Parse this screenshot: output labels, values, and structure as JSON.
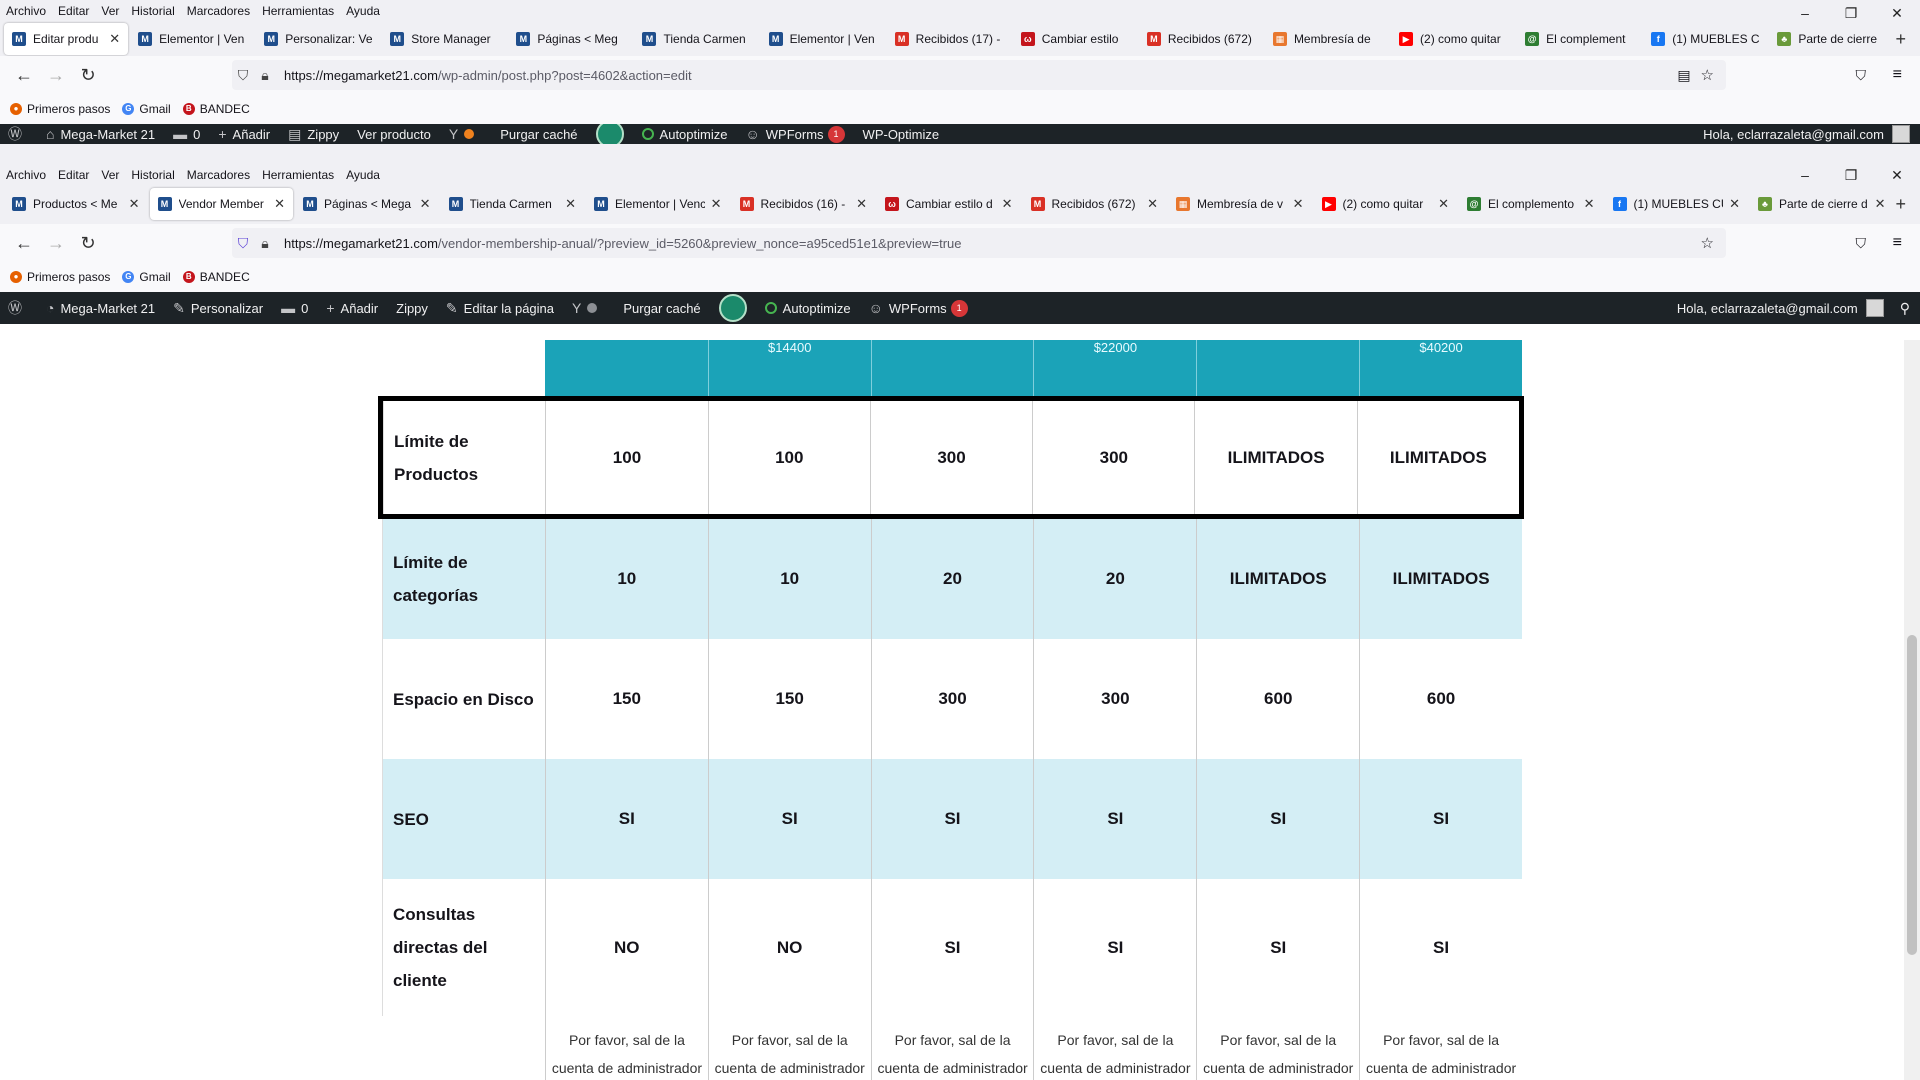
{
  "menu": [
    "Archivo",
    "Editar",
    "Ver",
    "Historial",
    "Marcadores",
    "Herramientas",
    "Ayuda"
  ],
  "w1": {
    "tabs": [
      {
        "label": "Editar produ",
        "icon": "M",
        "color": "#1f4e8c",
        "active": true
      },
      {
        "label": "Elementor | Ven",
        "icon": "M",
        "color": "#1f4e8c"
      },
      {
        "label": "Personalizar: Ve",
        "icon": "M",
        "color": "#1f4e8c"
      },
      {
        "label": "Store Manager",
        "icon": "M",
        "color": "#1f4e8c"
      },
      {
        "label": "Páginas < Meg",
        "icon": "M",
        "color": "#1f4e8c"
      },
      {
        "label": "Tienda Carmen",
        "icon": "M",
        "color": "#1f4e8c"
      },
      {
        "label": "Elementor | Ven",
        "icon": "M",
        "color": "#1f4e8c"
      },
      {
        "label": "Recibidos (17) -",
        "icon": "M",
        "color": "#d93025"
      },
      {
        "label": "Cambiar estilo",
        "icon": "ω",
        "color": "#c4151c"
      },
      {
        "label": "Recibidos (672)",
        "icon": "M",
        "color": "#d93025"
      },
      {
        "label": "Membresía de",
        "icon": "▦",
        "color": "#e8772e"
      },
      {
        "label": "(2) como quitar",
        "icon": "▶",
        "color": "#ff0000"
      },
      {
        "label": "El complement",
        "icon": "@",
        "color": "#2e7d32"
      },
      {
        "label": "(1) MUEBLES C",
        "icon": "f",
        "color": "#1877f2"
      },
      {
        "label": "Parte de cierre",
        "icon": "♣",
        "color": "#6a9a3a"
      }
    ],
    "url_host": "https://megamarket21.com",
    "url_path": "/wp-admin/post.php?post=4602&action=edit",
    "admin": {
      "site": "Mega-Market 21",
      "comments": "0",
      "add": "Añadir",
      "zippy": "Zippy",
      "view": "Ver producto",
      "cache": "Purgar caché",
      "autoptimize": "Autoptimize",
      "wpforms": "WPForms",
      "wpforms_badge": "1",
      "wpoptimize": "WP-Optimize",
      "greeting": "Hola, eclarrazaleta@gmail.com"
    }
  },
  "w2": {
    "tabs": [
      {
        "label": "Productos < Me",
        "icon": "M",
        "color": "#1f4e8c"
      },
      {
        "label": "Vendor Member",
        "icon": "M",
        "color": "#1f4e8c",
        "active": true
      },
      {
        "label": "Páginas < Mega",
        "icon": "M",
        "color": "#1f4e8c"
      },
      {
        "label": "Tienda Carmen",
        "icon": "M",
        "color": "#1f4e8c"
      },
      {
        "label": "Elementor | Venc",
        "icon": "M",
        "color": "#1f4e8c"
      },
      {
        "label": "Recibidos (16) -",
        "icon": "M",
        "color": "#d93025"
      },
      {
        "label": "Cambiar estilo d",
        "icon": "ω",
        "color": "#c4151c"
      },
      {
        "label": "Recibidos (672)",
        "icon": "M",
        "color": "#d93025"
      },
      {
        "label": "Membresía de v",
        "icon": "▦",
        "color": "#e8772e"
      },
      {
        "label": "(2) como quitar",
        "icon": "▶",
        "color": "#ff0000"
      },
      {
        "label": "El complemento",
        "icon": "@",
        "color": "#2e7d32"
      },
      {
        "label": "(1) MUEBLES CU",
        "icon": "f",
        "color": "#1877f2"
      },
      {
        "label": "Parte de cierre d",
        "icon": "♣",
        "color": "#6a9a3a"
      }
    ],
    "url_host": "https://megamarket21.com",
    "url_path": "/vendor-membership-anual/?preview_id=5260&preview_nonce=a95ced51e1&preview=true",
    "admin": {
      "site": "Mega-Market 21",
      "customize": "Personalizar",
      "comments": "0",
      "add": "Añadir",
      "zippy": "Zippy",
      "edit": "Editar la página",
      "cache": "Purgar caché",
      "autoptimize": "Autoptimize",
      "wpforms": "WPForms",
      "wpforms_badge": "1",
      "greeting": "Hola, eclarrazaleta@gmail.com"
    }
  },
  "bookmarks": [
    "Primeros pasos",
    "Gmail",
    "BANDEC"
  ],
  "table": {
    "header_prices": [
      "",
      "$14400",
      "",
      "$22000",
      "",
      "$40200"
    ],
    "rows": [
      {
        "label": "Límite de Productos",
        "values": [
          "100",
          "100",
          "300",
          "300",
          "ILIMITADOS",
          "ILIMITADOS"
        ]
      },
      {
        "label": "Límite de categorías",
        "values": [
          "10",
          "10",
          "20",
          "20",
          "ILIMITADOS",
          "ILIMITADOS"
        ]
      },
      {
        "label": "Espacio en Disco",
        "values": [
          "150",
          "150",
          "300",
          "300",
          "600",
          "600"
        ]
      },
      {
        "label": "SEO",
        "values": [
          "SI",
          "SI",
          "SI",
          "SI",
          "SI",
          "SI"
        ]
      },
      {
        "label": "Consultas directas del cliente",
        "values": [
          "NO",
          "NO",
          "SI",
          "SI",
          "SI",
          "SI"
        ]
      }
    ],
    "footer_note": "Por favor, sal de la cuenta de administrador"
  }
}
